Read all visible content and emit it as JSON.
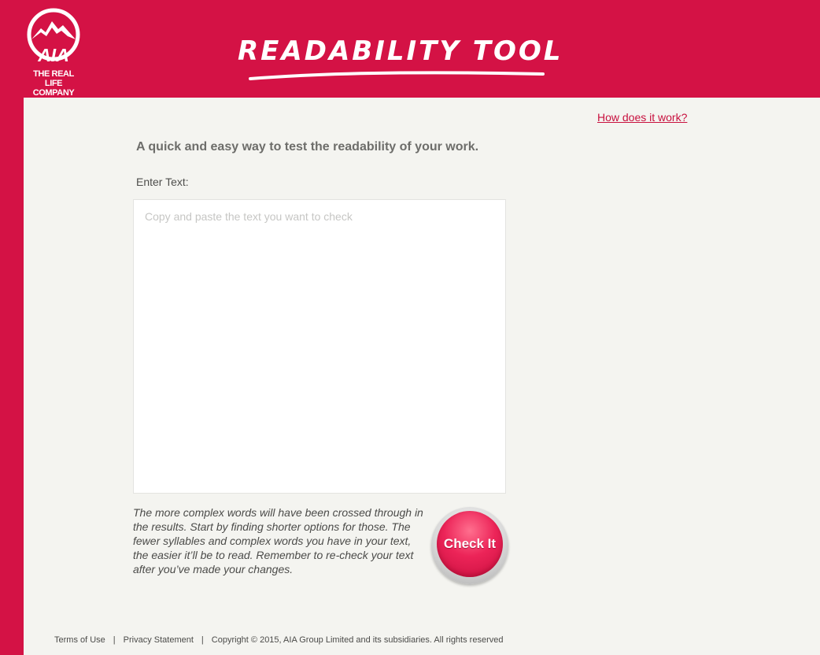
{
  "header": {
    "logo_mark": "AIA",
    "logo_tagline_line1": "THE REAL LIFE",
    "logo_tagline_line2": "COMPANY",
    "title": "READABILITY TOOL"
  },
  "main": {
    "help_link": "How does it work?",
    "tagline": "A quick and easy way to test the readability of your work.",
    "enter_label": "Enter Text:",
    "textarea": {
      "value": "",
      "placeholder": "Copy and paste the text you want to check"
    },
    "instructions": "The more complex words will have been crossed through in the results. Start by finding shorter options for those. The fewer syllables and complex words you have in your text, the easier it’ll be to read. Remember to re-check your text after you’ve made your changes.",
    "check_button_label": "Check It"
  },
  "footer": {
    "terms": "Terms of Use",
    "separator": "|",
    "privacy": "Privacy Statement",
    "copyright": "Copyright © 2015, AIA Group Limited and its subsidiaries. All rights reserved"
  },
  "colors": {
    "brand_red": "#d41245",
    "page_background": "#f4f4f0",
    "link_red": "#c8103e"
  },
  "icons": {
    "logo": "aia-mountain-logo-icon"
  }
}
